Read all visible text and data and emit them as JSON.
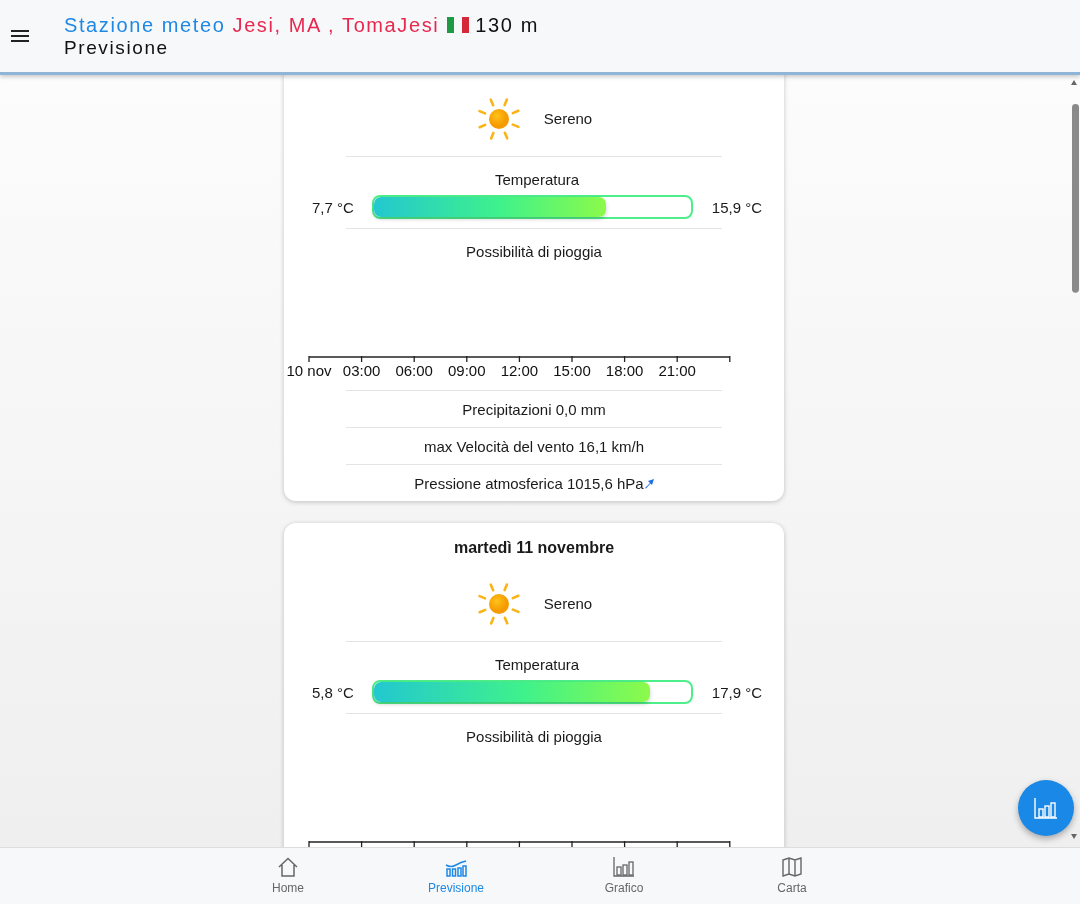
{
  "header": {
    "title_prefix": "Stazione meteo",
    "location": "Jesi, MA , TomaJesi",
    "altitude": "130 m",
    "subtitle": "Previsione"
  },
  "days": [
    {
      "condition": "Sereno",
      "temperature_label": "Temperatura",
      "min": "7,7 °C",
      "max": "15,9 °C",
      "level": 0.73,
      "rain_label": "Possibilità di pioggia",
      "axis_labels": [
        "10 nov",
        "03:00",
        "06:00",
        "09:00",
        "12:00",
        "15:00",
        "18:00",
        "21:00"
      ],
      "details": [
        "Precipitazioni 0,0 mm",
        "max Velocità del vento 16,1 km/h"
      ],
      "pressure": "Pressione atmosferica 1015,6 hPa"
    },
    {
      "date": "martedì 11 novembre",
      "condition": "Sereno",
      "temperature_label": "Temperatura",
      "min": "5,8 °C",
      "max": "17,9 °C",
      "level": 0.87,
      "rain_label": "Possibilità di pioggia"
    }
  ],
  "nav": [
    {
      "label": "Home",
      "selected": false
    },
    {
      "label": "Previsione",
      "selected": true
    },
    {
      "label": "Grafico",
      "selected": false
    },
    {
      "label": "Carta",
      "selected": false
    }
  ]
}
